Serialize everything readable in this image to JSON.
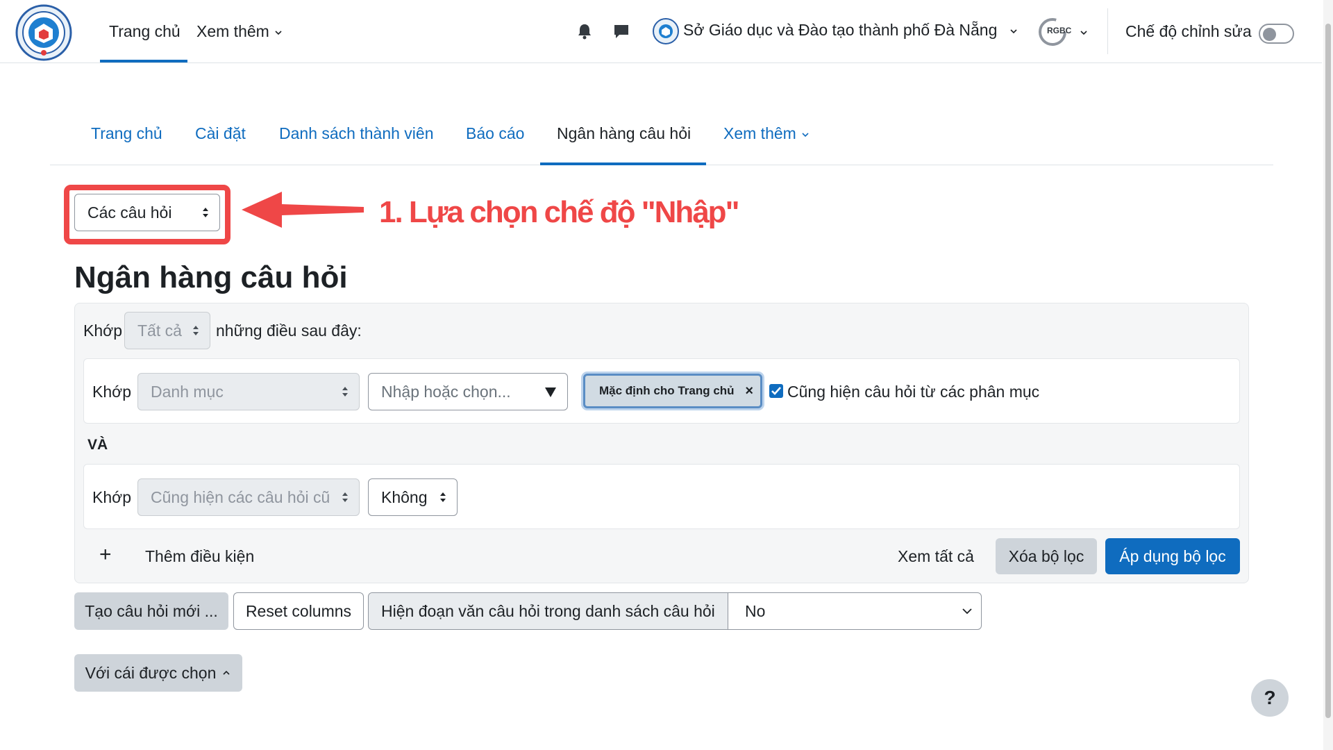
{
  "navbar": {
    "home": "Trang chủ",
    "more": "Xem thêm",
    "user_name": "Sở Giáo dục và Đào tạo thành phố Đà Nẵng",
    "rgbc": "RGBC",
    "edit_mode": "Chế độ chỉnh sửa",
    "edit_mode_on": false
  },
  "secondary_nav": {
    "tabs": [
      "Trang chủ",
      "Cài đặt",
      "Danh sách thành viên",
      "Báo cáo",
      "Ngân hàng câu hỏi",
      "Xem thêm"
    ],
    "active": "Ngân hàng câu hỏi"
  },
  "mode_select": {
    "value": "Các câu hỏi"
  },
  "annotation": {
    "text": "1. Lựa chọn chế độ \"Nhập\"",
    "color": "#ef4747"
  },
  "page_title": "Ngân hàng câu hỏi",
  "filter": {
    "match_label": "Khớp",
    "match_value": "Tất cả",
    "match_suffix": "những điều sau đây:",
    "cond1": {
      "label": "Khớp",
      "type": "Danh mục",
      "placeholder": "Nhập hoặc chọn...",
      "chip": "Mặc định cho Trang chủ",
      "chip_close": "×",
      "checkbox_label": "Cũng hiện câu hỏi từ các phân mục",
      "checked": true
    },
    "and_label": "VÀ",
    "cond2": {
      "label": "Khớp",
      "type": "Cũng hiện các câu hỏi cũ",
      "value": "Không"
    },
    "add_condition": "Thêm điều kiện",
    "add_icon": "+",
    "view_all": "Xem tất cả",
    "clear": "Xóa bộ lọc",
    "apply": "Áp dụng bộ lọc"
  },
  "toolbar": {
    "create": "Tạo câu hỏi mới ...",
    "reset": "Reset columns",
    "show_text_label": "Hiện đoạn văn câu hỏi trong danh sách câu hỏi",
    "show_text_value": "No",
    "with_selected": "Với cái được chọn"
  },
  "help": "?",
  "colors": {
    "primary": "#0f6cbf",
    "secondary": "#ced4da",
    "annotation": "#ef4747"
  }
}
